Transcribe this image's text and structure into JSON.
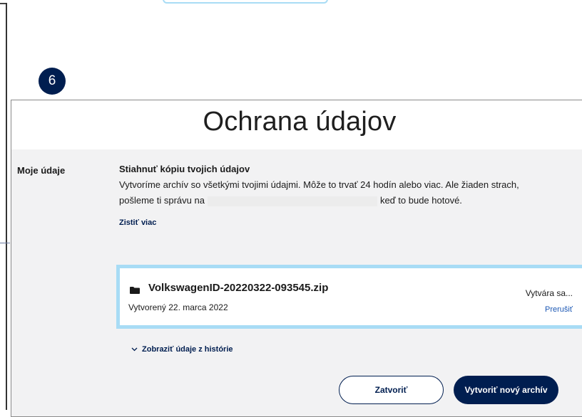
{
  "step": {
    "number": "6"
  },
  "dialog": {
    "title": "Ochrana údajov",
    "section_label": "Moje údaje",
    "download": {
      "title": "Stiahnuť kópiu tvojich údajov",
      "text_before": "Vytvoríme archív so všetkými tvojimi údajmi. Môže to trvať 24 hodín alebo viac. Ale žiaden strach, pošleme ti správu na",
      "text_after": "keď to bude hotové.",
      "learn_more": "Zistiť viac"
    },
    "archive": {
      "file_name": "VolkswagenID-20220322-093545.zip",
      "created": "Vytvorený 22. marca 2022",
      "status": "Vytvára sa...",
      "cancel": "Prerušiť"
    },
    "history_toggle": "Zobraziť údaje z histórie",
    "buttons": {
      "close": "Zatvoriť",
      "create_new": "Vytvoriť nový archív"
    }
  },
  "colors": {
    "brand": "#001e50",
    "highlight": "#a8dcf5",
    "link": "#1b57b4",
    "body_bg": "#f2f2f3"
  }
}
